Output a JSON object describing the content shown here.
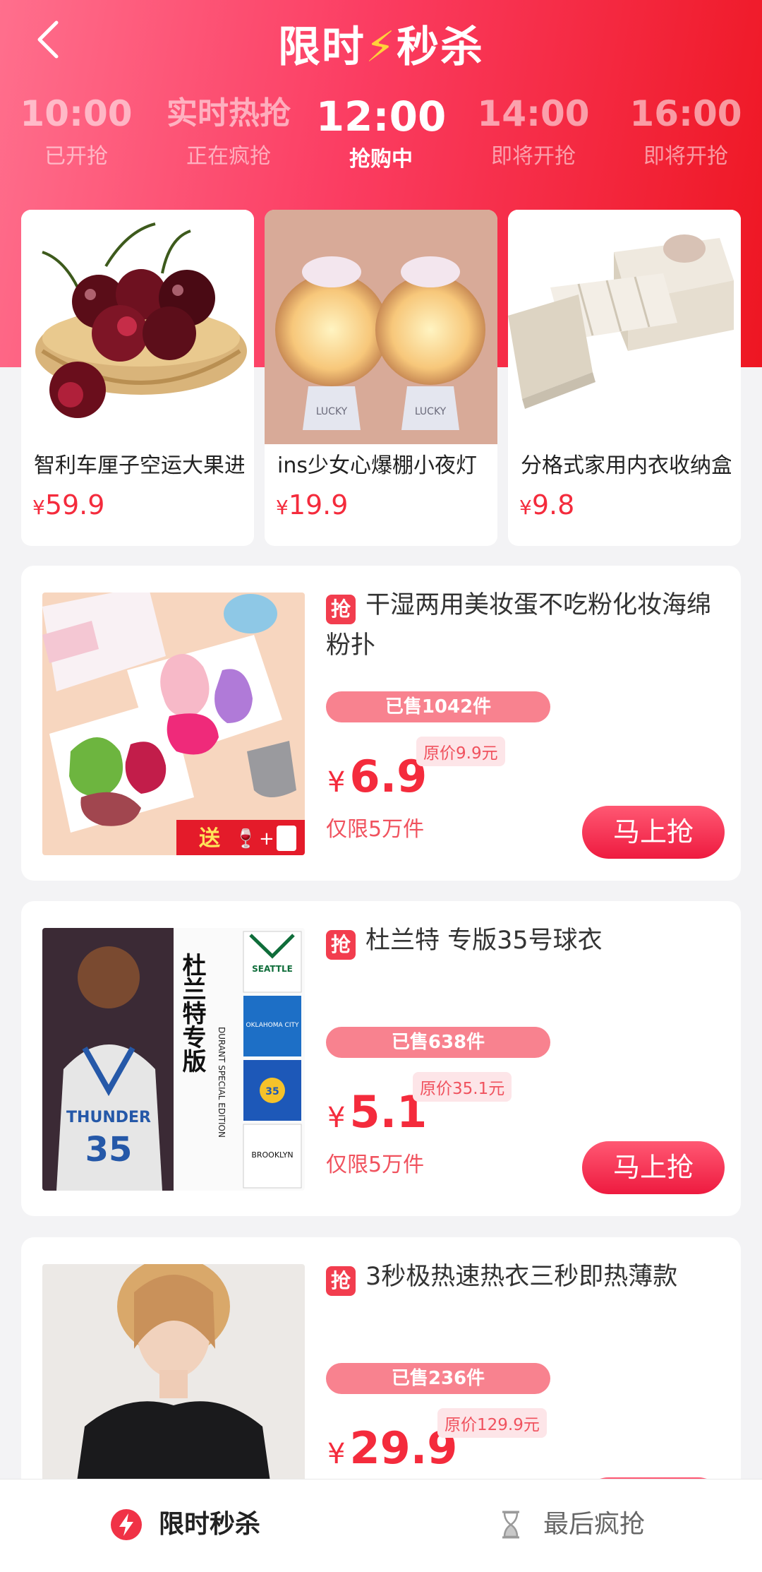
{
  "header": {
    "title_left": "限时",
    "title_right": "秒杀",
    "colors": {
      "gradient_start": "#ff6f8d",
      "gradient_end": "#ee1622",
      "accent": "#f42b3c"
    }
  },
  "time_slots": [
    {
      "time": "10:00",
      "status": "已开抢",
      "active": false
    },
    {
      "time": "实时热抢",
      "status": "正在疯抢",
      "active": false
    },
    {
      "time": "12:00",
      "status": "抢购中",
      "active": true
    },
    {
      "time": "14:00",
      "status": "即将开抢",
      "active": false
    },
    {
      "time": "16:00",
      "status": "即将开抢",
      "active": false
    }
  ],
  "featured": [
    {
      "name": "智利车厘子空运大果进口新鲜水果",
      "currency": "¥",
      "price": "59.9",
      "image": "cherries"
    },
    {
      "name": "ins少女心爆棚小夜灯",
      "currency": "¥",
      "price": "19.9",
      "image": "unicorn-night-lights"
    },
    {
      "name": "分格式家用内衣收纳盒",
      "currency": "¥",
      "price": "9.8",
      "image": "storage-boxes"
    }
  ],
  "products": [
    {
      "tag": "抢",
      "name": "干湿两用美妆蛋不吃粉化妆海绵粉扑",
      "sold": "已售1042件",
      "currency": "¥",
      "price": "6.9",
      "original": "原价9.9元",
      "limit": "仅限5万件",
      "buy_label": "马上抢",
      "promo": "送",
      "image": "makeup-sponges"
    },
    {
      "tag": "抢",
      "name": "杜兰特 专版35号球衣",
      "sold": "已售638件",
      "currency": "¥",
      "price": "5.1",
      "original": "原价35.1元",
      "limit": "仅限5万件",
      "buy_label": "马上抢",
      "poster_title": "杜兰特专版",
      "poster_subtitle": "DURANT SPECIAL EDITION",
      "jersey_number": "35",
      "jersey_labels": [
        "SEATTLE",
        "OKLAHOMA CITY",
        "35",
        "BROOKLYN"
      ],
      "image": "basketball-jerseys"
    },
    {
      "tag": "抢",
      "name": "3秒极热速热衣三秒即热薄款",
      "sold": "已售236件",
      "currency": "¥",
      "price": "29.9",
      "original": "原价129.9元",
      "image": "thermal-top"
    }
  ],
  "tabbar": [
    {
      "label": "限时秒杀",
      "icon": "lightning-icon",
      "active": true
    },
    {
      "label": "最后疯抢",
      "icon": "hourglass-icon",
      "active": false
    }
  ]
}
